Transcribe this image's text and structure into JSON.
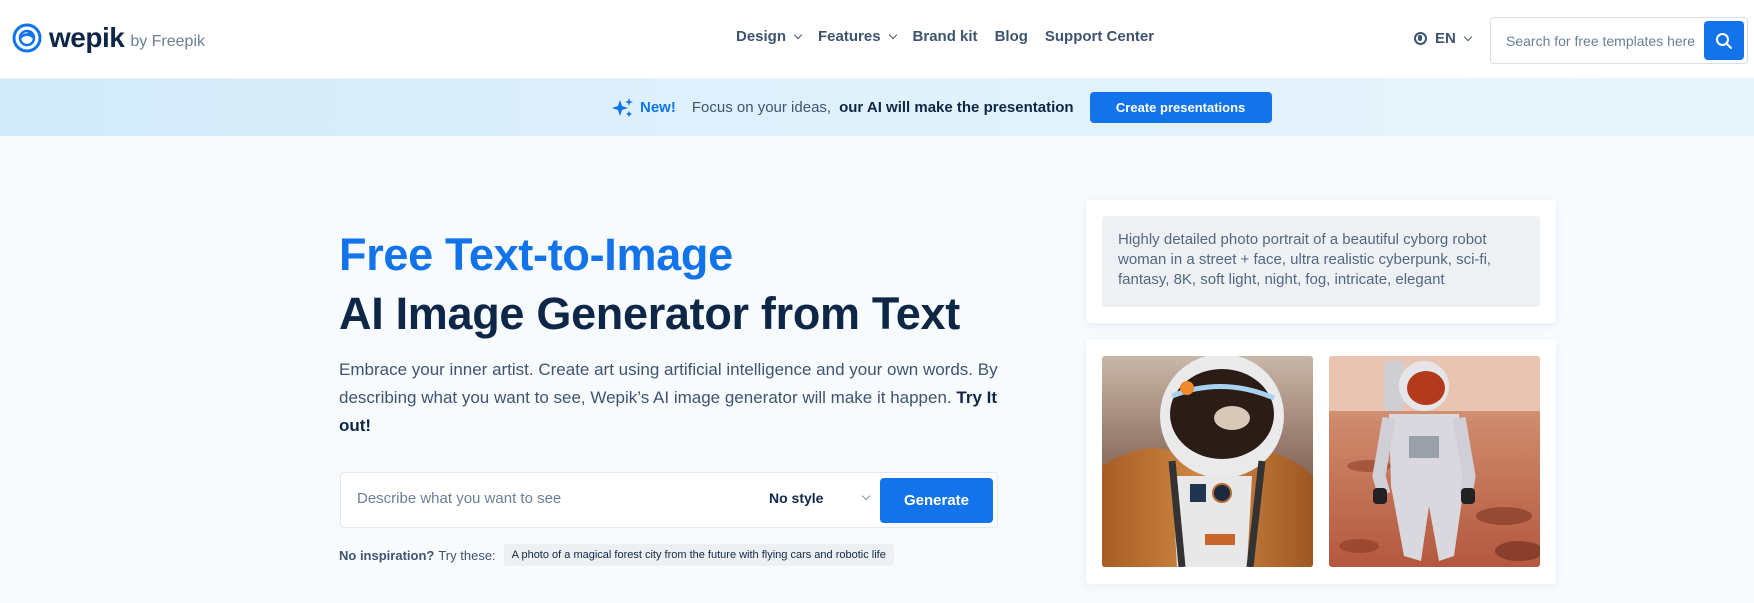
{
  "header": {
    "logo": {
      "brand": "wepik",
      "by": "by Freepik"
    },
    "nav": [
      {
        "label": "Design",
        "has_dropdown": true
      },
      {
        "label": "Features",
        "has_dropdown": true
      },
      {
        "label": "Brand kit",
        "has_dropdown": false
      },
      {
        "label": "Blog",
        "has_dropdown": false
      },
      {
        "label": "Support Center",
        "has_dropdown": false
      }
    ],
    "language": "EN",
    "search": {
      "placeholder": "Search for free templates here",
      "value": ""
    }
  },
  "banner": {
    "new_label": "New!",
    "text": "Focus on your ideas,",
    "bold_text": "our AI will make the presentation",
    "button_label": "Create presentations"
  },
  "hero": {
    "title_line1": "Free Text-to-Image",
    "title_line2": "AI Image Generator from Text",
    "description": "Embrace your inner artist. Create art using artificial intelligence and your own words. By describing what you want to see, Wepik’s AI image generator will make it happen.",
    "description_cta": "Try It out!",
    "generator": {
      "placeholder": "Describe what you want to see",
      "value": "",
      "style_selected": "No style",
      "button_label": "Generate"
    },
    "inspiration": {
      "label": "No inspiration?",
      "try_label": "Try these:",
      "suggestion": "A photo of a magical forest city from the future with flying cars and robotic life"
    }
  },
  "example": {
    "prompt": "Highly detailed photo portrait of a beautiful cyborg robot woman in a street + face, ultra realistic cyberpunk, sci-fi, fantasy, 8K, soft light, night, fog, intricate, elegant",
    "images": [
      {
        "alt": "Astronaut close-up in orange suit with reflective helmet"
      },
      {
        "alt": "Astronaut standing on red Mars terrain"
      }
    ]
  },
  "colors": {
    "accent": "#1273eb",
    "heading": "#0f2747",
    "body_text": "#3f5470"
  }
}
